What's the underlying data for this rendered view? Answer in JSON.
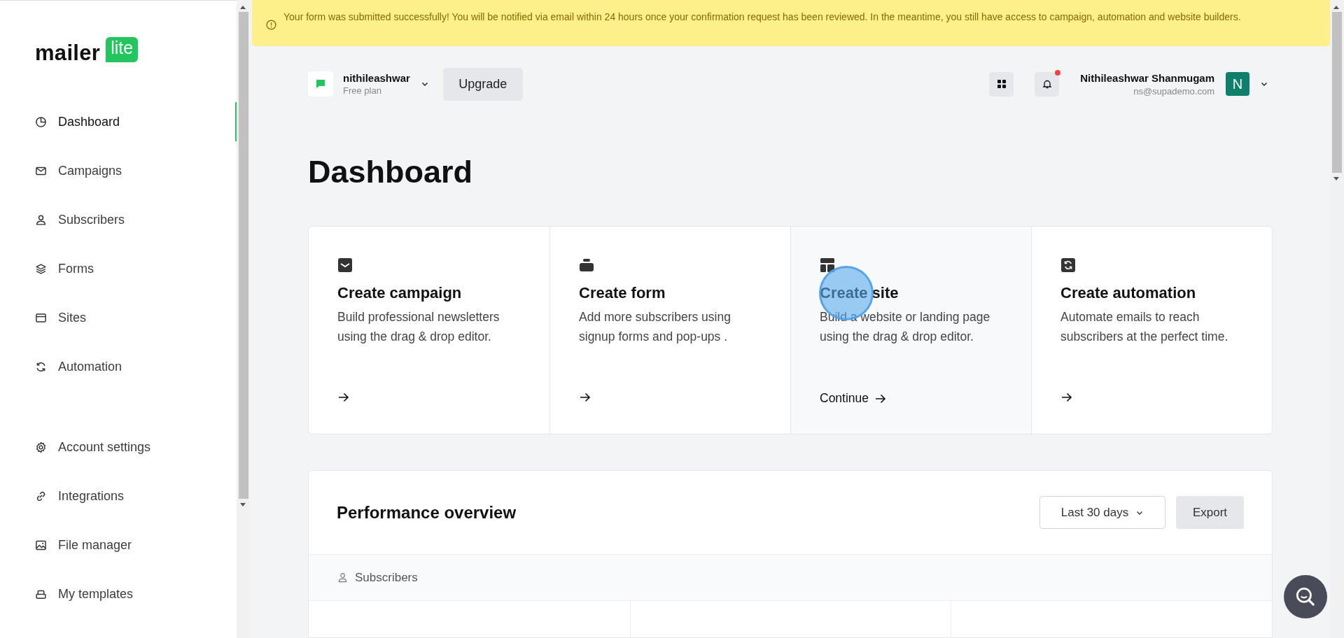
{
  "logo": {
    "word": "mailer",
    "badge": "lite"
  },
  "sidebar": {
    "main_items": [
      {
        "label": "Dashboard",
        "selected": true
      },
      {
        "label": "Campaigns",
        "selected": false
      },
      {
        "label": "Subscribers",
        "selected": false
      },
      {
        "label": "Forms",
        "selected": false
      },
      {
        "label": "Sites",
        "selected": false
      },
      {
        "label": "Automation",
        "selected": false
      }
    ],
    "settings_items": [
      {
        "label": "Account settings",
        "selected": false
      },
      {
        "label": "Integrations",
        "selected": false
      },
      {
        "label": "File manager",
        "selected": false
      },
      {
        "label": "My templates",
        "selected": false
      }
    ]
  },
  "banner": {
    "message": "Your form was submitted successfully! You will be notified via email within 24 hours once your confirmation request has been reviewed. In the meantime, you still have access to campaign, automation and website builders."
  },
  "header": {
    "workspace": {
      "name": "nithileashwar",
      "plan": "Free plan"
    },
    "upgrade_button": "Upgrade",
    "notifications_unread": true,
    "user": {
      "name": "Nithileashwar Shanmugam",
      "email": "ns@supademo.com",
      "initial": "N"
    }
  },
  "page_title": "Dashboard",
  "action_cards": [
    {
      "title": "Create campaign",
      "description": "Build professional newsletters using the drag & drop editor.",
      "hovered": false
    },
    {
      "title": "Create form",
      "description": "Add more subscribers using signup forms and pop-ups .",
      "hovered": false
    },
    {
      "title": "Create site",
      "description": "Build a website or landing page using the drag & drop editor.",
      "hovered": true,
      "link_label": "Continue"
    },
    {
      "title": "Create automation",
      "description": "Automate emails to reach subscribers at the perfect time.",
      "hovered": false
    }
  ],
  "performance": {
    "title": "Performance overview",
    "range_select": "Last 30 days",
    "export_button": "Export",
    "section": "Subscribers"
  }
}
